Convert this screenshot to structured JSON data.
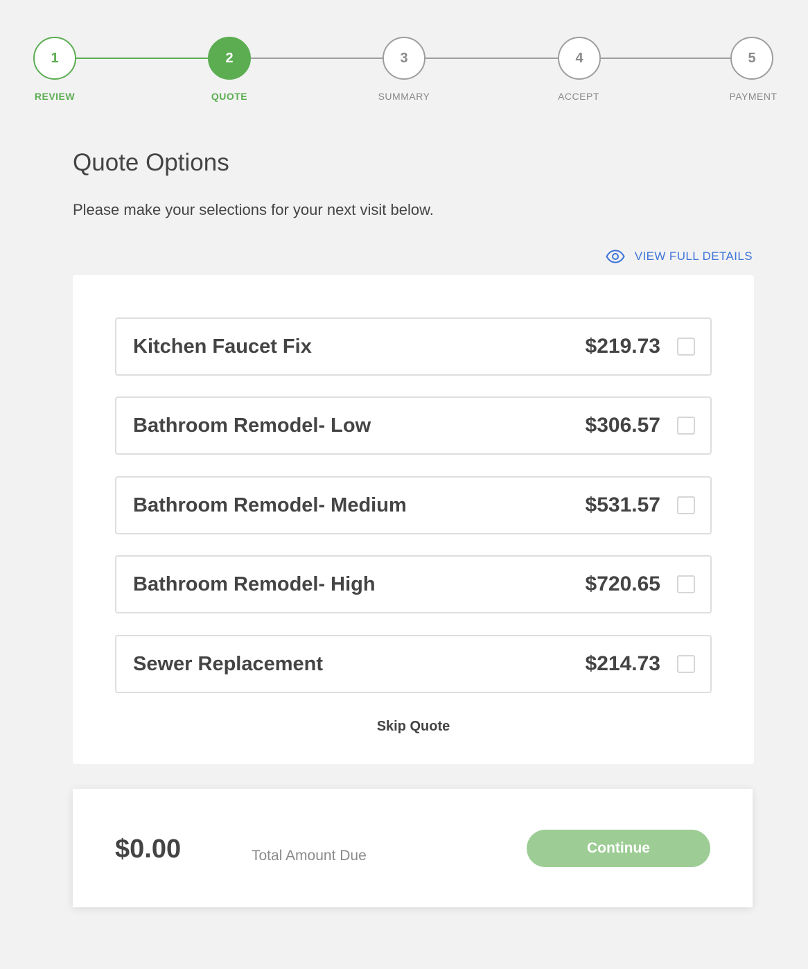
{
  "stepper": {
    "steps": [
      {
        "number": "1",
        "label": "REVIEW",
        "state": "done"
      },
      {
        "number": "2",
        "label": "QUOTE",
        "state": "active"
      },
      {
        "number": "3",
        "label": "SUMMARY",
        "state": "todo"
      },
      {
        "number": "4",
        "label": "ACCEPT",
        "state": "todo"
      },
      {
        "number": "5",
        "label": "PAYMENT",
        "state": "todo"
      }
    ]
  },
  "header": {
    "title": "Quote Options",
    "subtitle": "Please make your selections for your next visit below.",
    "details_link": "VIEW FULL DETAILS",
    "details_icon": "eye-icon"
  },
  "options": [
    {
      "name": "Kitchen Faucet Fix",
      "price": "$219.73",
      "checked": false
    },
    {
      "name": "Bathroom Remodel- Low",
      "price": "$306.57",
      "checked": false
    },
    {
      "name": "Bathroom Remodel- Medium",
      "price": "$531.57",
      "checked": false
    },
    {
      "name": "Bathroom Remodel- High",
      "price": "$720.65",
      "checked": false
    },
    {
      "name": "Sewer Replacement",
      "price": "$214.73",
      "checked": false
    }
  ],
  "skip_label": "Skip Quote",
  "footer": {
    "total_amount": "$0.00",
    "total_label": "Total Amount Due",
    "continue_label": "Continue"
  },
  "colors": {
    "accent_green": "#5cad52",
    "button_green_disabled": "#9dcd95",
    "link_blue": "#3e74d8",
    "inactive_gray": "#9e9e9e"
  }
}
